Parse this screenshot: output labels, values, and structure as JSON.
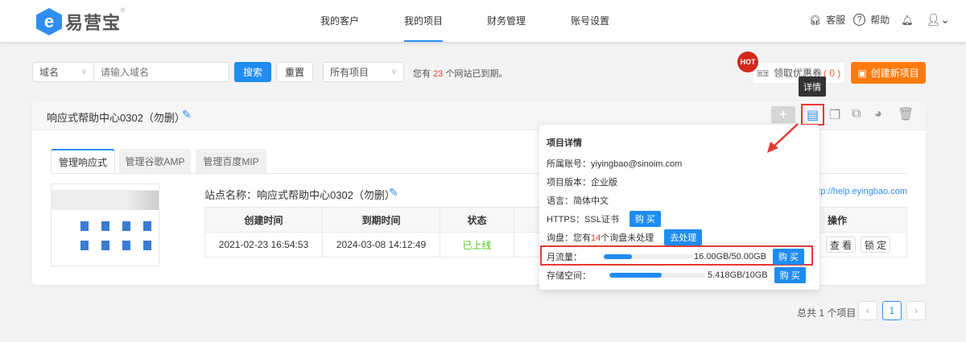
{
  "header": {
    "logo_text": "易营宝",
    "logo_mark": "®",
    "nav": [
      {
        "label": "我的客户"
      },
      {
        "label": "我的项目",
        "active": true
      },
      {
        "label": "财务管理"
      },
      {
        "label": "账号设置"
      }
    ],
    "service": "客服",
    "help": "帮助"
  },
  "toolbar": {
    "field_select": "域名",
    "search_placeholder": "请输入域名",
    "search_label": "搜索",
    "reset_label": "重置",
    "project_filter": "所有项目",
    "expired_prefix": "您有",
    "expired_count": "23",
    "expired_suffix": "个网站已到期。",
    "hot_badge": "HOT",
    "coupon_label": "领取优惠券",
    "coupon_count": "( 0 )",
    "create_label": "创建新项目"
  },
  "tooltip": "详情",
  "project": {
    "title": "响应式帮助中心0302（勿删）",
    "tabs": [
      "管理响应式",
      "管理谷歌AMP",
      "管理百度MIP"
    ],
    "site_name": "站点名称：响应式帮助中心0302（勿删）",
    "url": "http://help.eyingbao.com",
    "table": {
      "headers": [
        "创建时间",
        "到期时间",
        "状态",
        "",
        "操作"
      ],
      "row": {
        "created": "2021-02-23 16:54:53",
        "expires": "2024-03-08 14:12:49",
        "status": "已上线",
        "view": "查 看",
        "lock": "锁 定"
      }
    }
  },
  "details": {
    "title": "项目详情",
    "account": "所属账号：yiyingbao@sinoim.com",
    "edition": "项目版本：企业版",
    "language": "语言：简体中文",
    "https": "HTTPS：SSL证书",
    "buy": "购 买",
    "inquiry_prefix": "询盘：您有",
    "inquiry_count": "14",
    "inquiry_suffix": "个询盘未处理",
    "handle": "去处理",
    "traffic_label": "月流量：",
    "traffic_value": "16.00GB/50.00GB",
    "traffic_fraction": 0.32,
    "storage_label": "存储空间：",
    "storage_value": "5.418GB/10GB",
    "storage_fraction": 0.5418
  },
  "pagination": {
    "total": "总共 1 个项目",
    "current": "1"
  },
  "colors": {
    "accent": "#1e8cf0",
    "orange": "#ff7a0d",
    "red": "#e53935",
    "green": "#52c41a"
  }
}
